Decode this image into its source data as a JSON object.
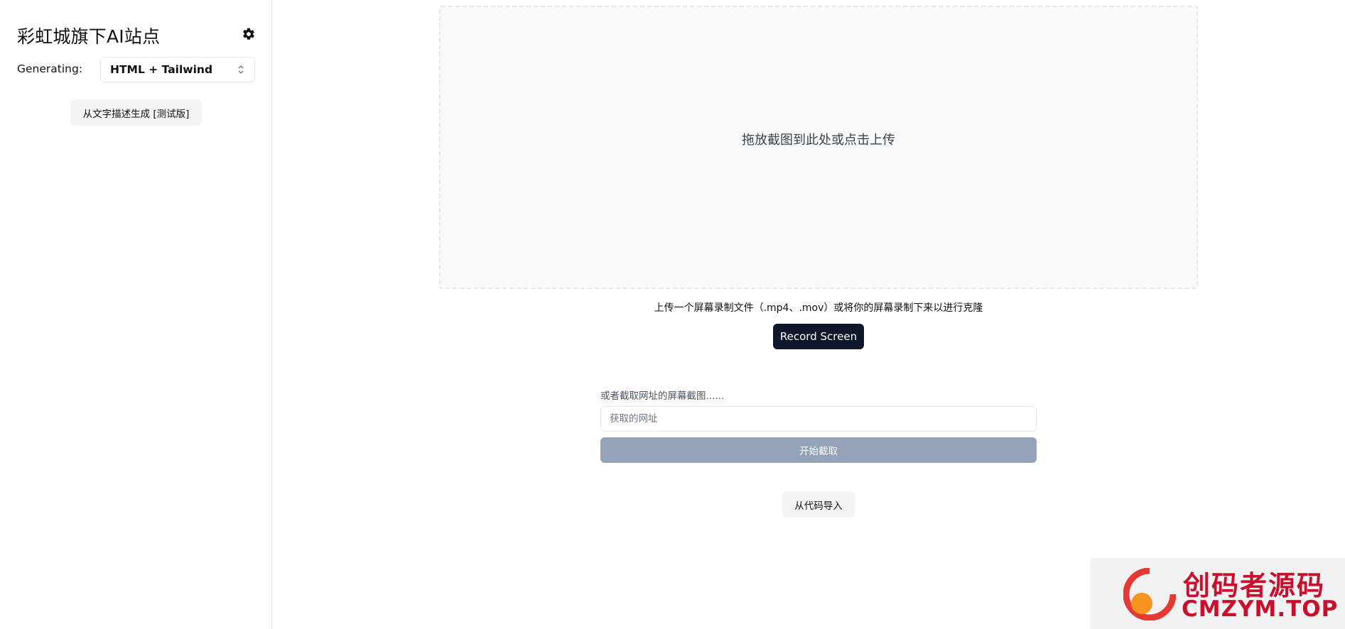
{
  "sidebar": {
    "brand": "彩虹城旗下AI站点",
    "generating_label": "Generating:",
    "stack_select": {
      "value": "HTML + Tailwind"
    },
    "text_gen_button": "从文字描述生成 [测试版]"
  },
  "main": {
    "dropzone_text": "拖放截图到此处或点击上传",
    "video_hint": "上传一个屏幕录制文件（.mp4、.mov）或将你的屏幕录制下来以进行克隆",
    "record_button": "Record Screen",
    "url_label": "或者截取网址的屏幕截图......",
    "url_input": {
      "value": "",
      "placeholder": "获取的网址"
    },
    "capture_button": "开始截取",
    "import_button": "从代码导入"
  },
  "watermark": {
    "cn": "创码者源码",
    "en": "CMZYM.TOP"
  },
  "colors": {
    "primary_button": "#0f172a",
    "disabled_button": "#94a3b8",
    "secondary_button": "#f3f4f6",
    "watermark_red": "#c8102e"
  },
  "icons": {
    "settings": "gear-icon",
    "select": "chevron-up-down-icon"
  }
}
